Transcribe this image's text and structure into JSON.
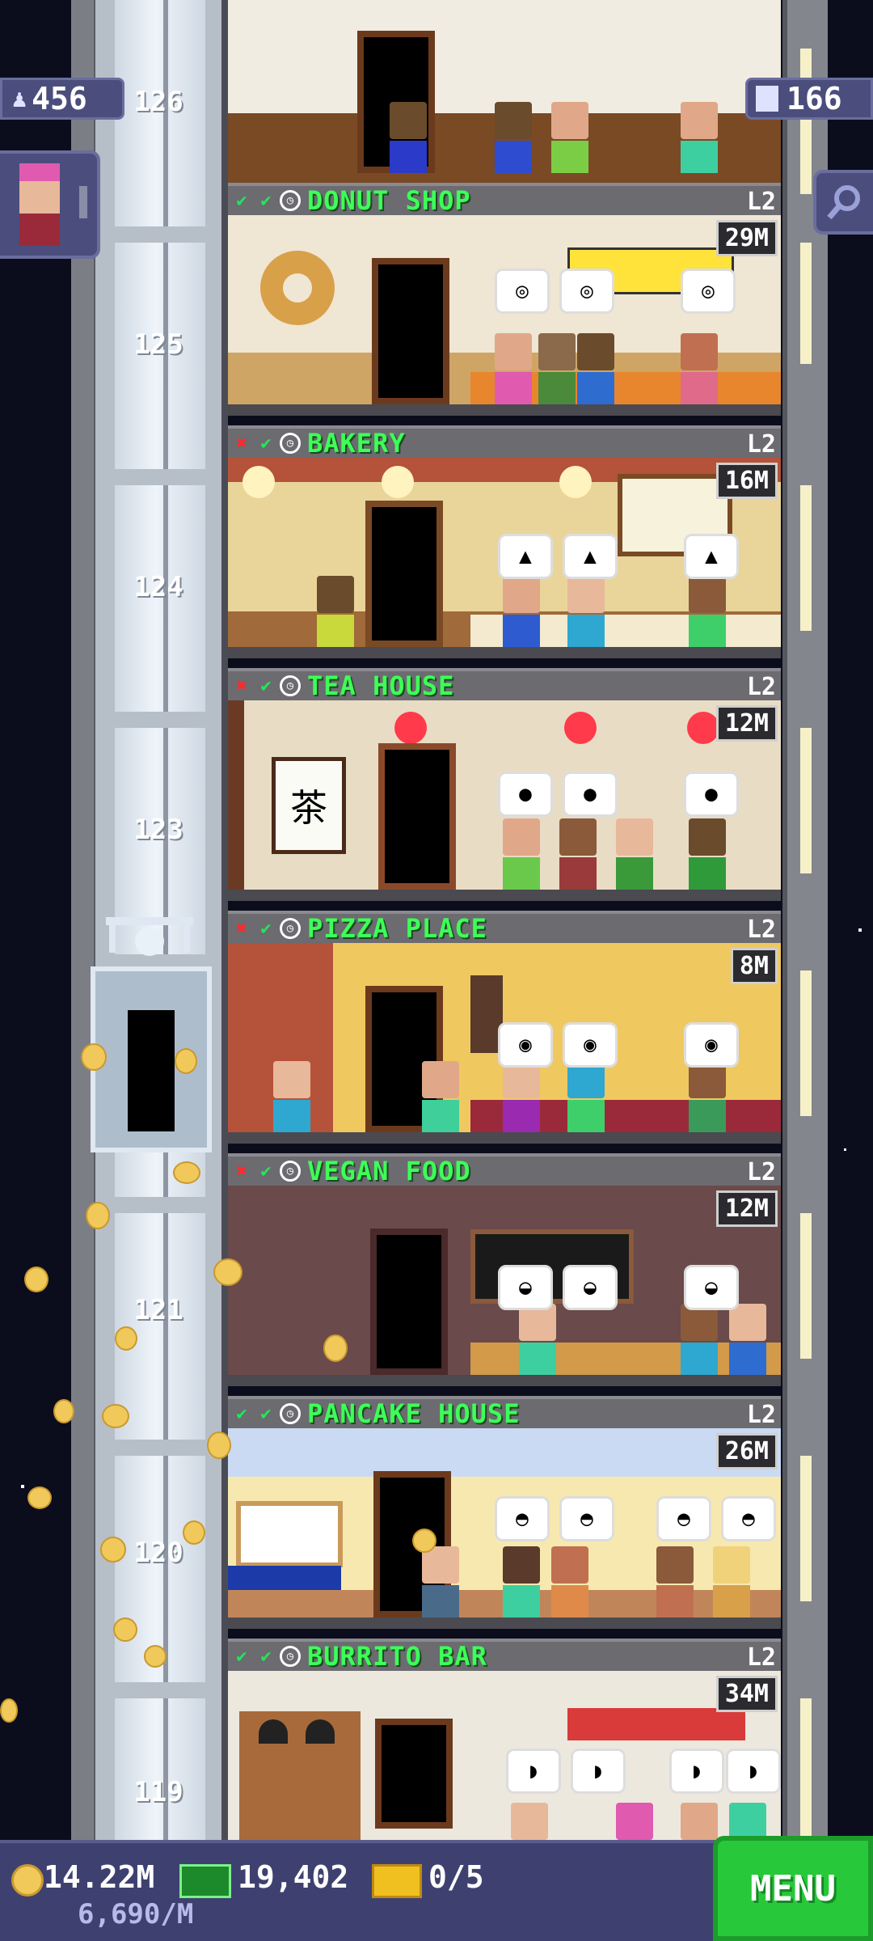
{
  "hud": {
    "population": "456",
    "floor_count": "166",
    "coins": "14.22M",
    "coins_per_minute": "6,690/M",
    "bux": "19,402",
    "tickets": "0/5",
    "menu_label": "MENU"
  },
  "shaft_floor_numbers": [
    "126",
    "125",
    "124",
    "123",
    "121",
    "120",
    "119"
  ],
  "floors": [
    {
      "name": "DONUT SHOP",
      "level": "L2",
      "earnings": "29M",
      "status": [
        "ok",
        "ok",
        "clock"
      ],
      "bubble": "◎"
    },
    {
      "name": "BAKERY",
      "level": "L2",
      "earnings": "16M",
      "status": [
        "x",
        "ok",
        "clock"
      ],
      "bubble": "▲"
    },
    {
      "name": "TEA HOUSE",
      "level": "L2",
      "earnings": "12M",
      "status": [
        "x",
        "ok",
        "clock"
      ],
      "bubble": "●"
    },
    {
      "name": "PIZZA PLACE",
      "level": "L2",
      "earnings": "8M",
      "status": [
        "x",
        "ok",
        "clock"
      ],
      "bubble": "◉"
    },
    {
      "name": "VEGAN FOOD",
      "level": "L2",
      "earnings": "12M",
      "status": [
        "x",
        "ok",
        "clock"
      ],
      "bubble": "◒"
    },
    {
      "name": "PANCAKE HOUSE",
      "level": "L2",
      "earnings": "26M",
      "status": [
        "ok",
        "ok",
        "clock"
      ],
      "bubble": "◓"
    },
    {
      "name": "BURRITO BAR",
      "level": "L2",
      "earnings": "34M",
      "status": [
        "ok",
        "ok",
        "clock"
      ],
      "bubble": "◗"
    }
  ],
  "colors": {
    "floor_name": "#3dff58",
    "status_x": "#ff2a2a",
    "status_ok": "#24e55a",
    "menu": "#27c93a",
    "hud_panel": "#4b4e7c"
  },
  "icons": {
    "population": "person-icon",
    "floor_count": "building-icon",
    "search": "magnifier-icon",
    "coins": "coin-icon",
    "bux": "bux-icon",
    "tickets": "ticket-icon"
  }
}
